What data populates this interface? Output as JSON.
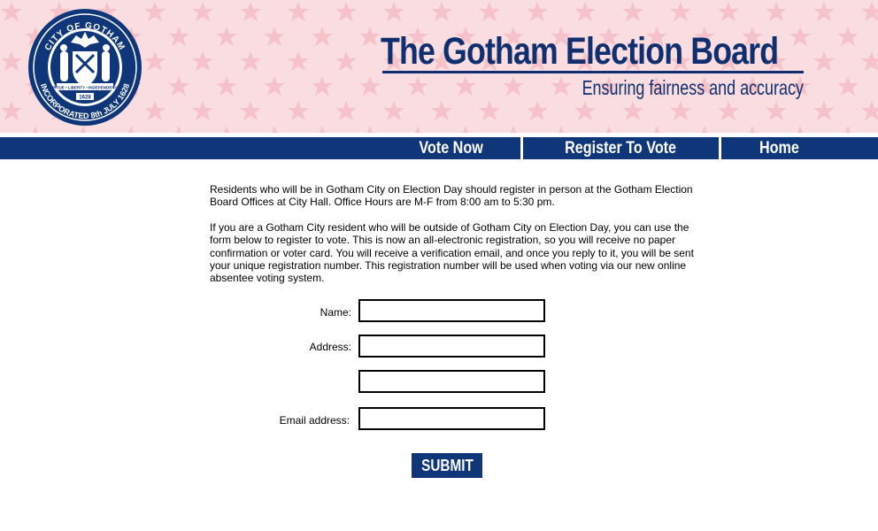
{
  "header": {
    "title": "The Gotham Election Board",
    "tagline": "Ensuring fairness and accuracy",
    "seal": {
      "top_text": "CITY OF GOTHAM",
      "bottom_text": "INCORPORATED 8th JULY 1628",
      "motto": "VIRTUE • LIBERTY • INDEPENDENCE",
      "year": "1628"
    }
  },
  "nav": {
    "items": [
      {
        "label": "Vote Now"
      },
      {
        "label": "Register To Vote"
      },
      {
        "label": "Home"
      }
    ]
  },
  "content": {
    "paragraph1": "Residents who will be in Gotham City on Election Day should register in person at the Gotham Election Board Offices at City Hall. Office Hours are M-F from 8:00 am to 5:30 pm.",
    "paragraph2": "If you are a Gotham City resident who will be outside of Gotham City on Election Day, you can use the form below to register to vote. This is now an all-electronic registration, so you will receive no paper confirmation or voter card. You will receive a verification email, and once you reply to it, you will be sent your unique registration number. This registration number will be used when voting via our new online absentee voting system."
  },
  "form": {
    "name_label": "Name:",
    "name_value": "",
    "address_label": "Address:",
    "address1_value": "",
    "address2_value": "",
    "email_label": "Email address:",
    "email_value": "",
    "submit_label": "SUBMIT"
  },
  "colors": {
    "brand_navy": "#0f3678",
    "header_pink": "#f9dde0",
    "star_pink": "#f4c2c8"
  }
}
